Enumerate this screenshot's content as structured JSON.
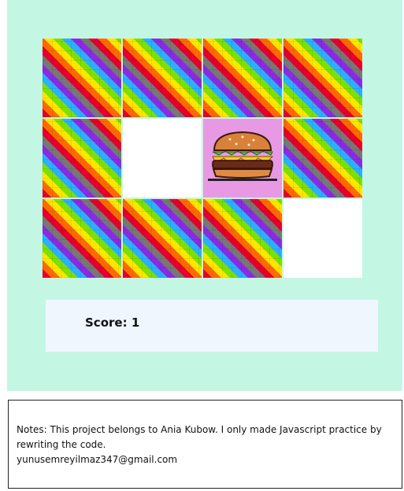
{
  "board": {
    "cards": [
      {
        "state": "back"
      },
      {
        "state": "back"
      },
      {
        "state": "back"
      },
      {
        "state": "back"
      },
      {
        "state": "back"
      },
      {
        "state": "blank"
      },
      {
        "state": "burger"
      },
      {
        "state": "back"
      },
      {
        "state": "back"
      },
      {
        "state": "back"
      },
      {
        "state": "back"
      },
      {
        "state": "blank"
      }
    ]
  },
  "score": {
    "label": "Score:",
    "value": "1"
  },
  "notes": {
    "line1": "Notes: This project belongs to Ania Kubow. I only made Javascript practice by rewriting the code.",
    "email": "yunusemreyilmaz347@gmail.com"
  },
  "colors": {
    "background": "#c3f7e4",
    "score_panel": "#f0f6fd",
    "burger_card": "#e79ae3"
  }
}
